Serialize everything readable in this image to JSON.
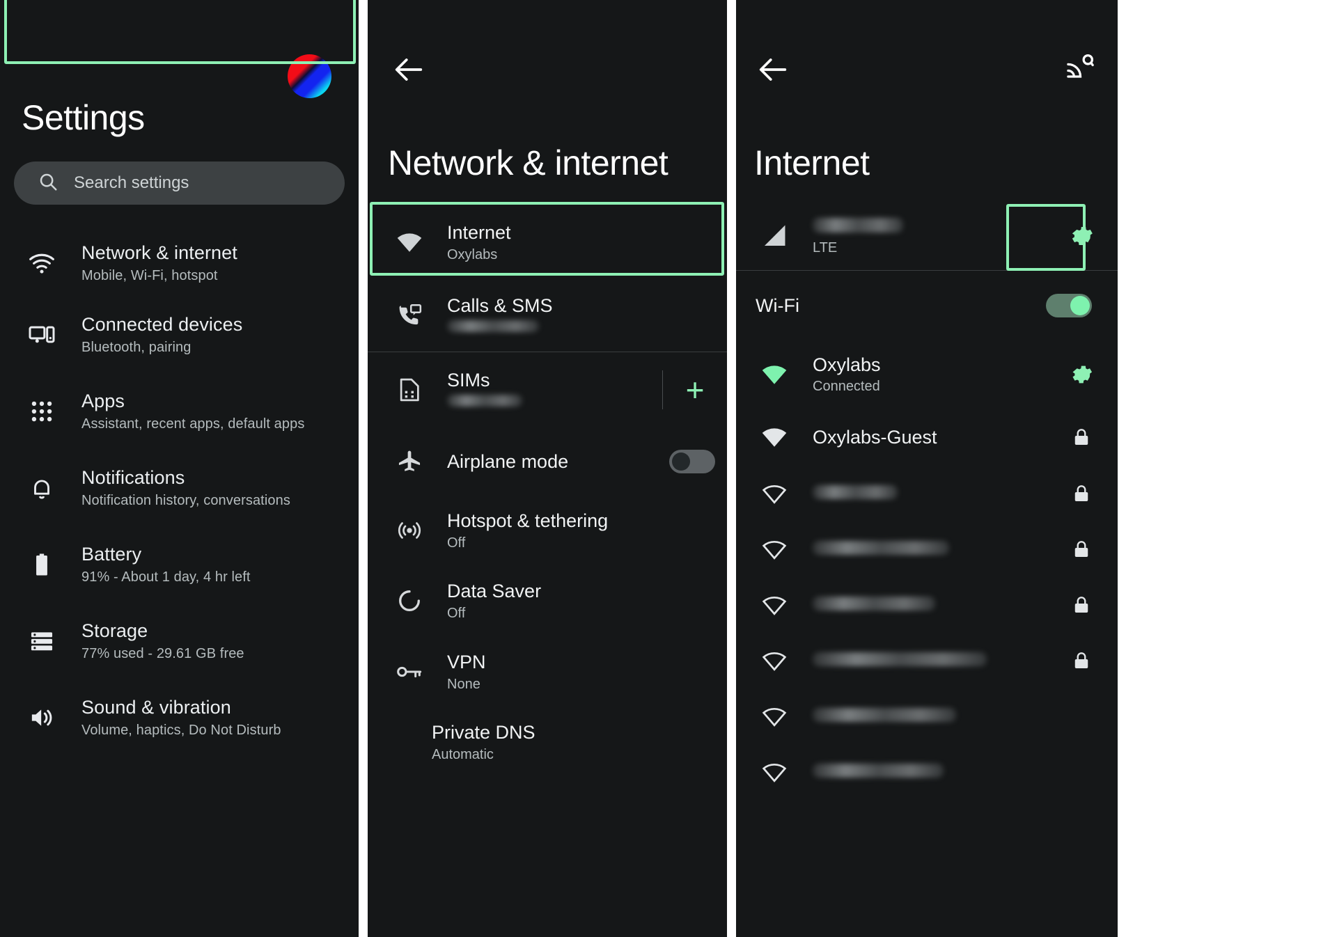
{
  "colors": {
    "background": "#151718",
    "accent_green": "#8ef0b4",
    "highlight_border": "#8ef0b4",
    "text_primary": "#f1f3f4",
    "text_secondary": "#b5bcbe",
    "divider": "#3a3d3f",
    "search_bar": "#3d4143"
  },
  "left_panel": {
    "avatar": "account-avatar",
    "title": "Settings",
    "search": {
      "icon": "search-icon",
      "placeholder": "Search settings",
      "value": ""
    },
    "items": [
      {
        "icon": "wifi-icon",
        "label": "Network & internet",
        "sub": "Mobile, Wi-Fi, hotspot",
        "highlighted": true
      },
      {
        "icon": "connected-devices-icon",
        "label": "Connected devices",
        "sub": "Bluetooth, pairing",
        "highlighted": false
      },
      {
        "icon": "apps-grid-icon",
        "label": "Apps",
        "sub": "Assistant, recent apps, default apps",
        "highlighted": false
      },
      {
        "icon": "bell-icon",
        "label": "Notifications",
        "sub": "Notification history, conversations",
        "highlighted": false
      },
      {
        "icon": "battery-icon",
        "label": "Battery",
        "sub": "91% - About 1 day, 4 hr left",
        "highlighted": false
      },
      {
        "icon": "storage-icon",
        "label": "Storage",
        "sub": "77% used - 29.61 GB free",
        "highlighted": false
      },
      {
        "icon": "volume-icon",
        "label": "Sound & vibration",
        "sub": "Volume, haptics, Do Not Disturb",
        "highlighted": false
      }
    ]
  },
  "mid_panel": {
    "back": "back-arrow-icon",
    "title": "Network & internet",
    "items": [
      {
        "icon": "wifi-icon",
        "label": "Internet",
        "sub": "Oxylabs",
        "sub_blurred": false,
        "highlighted": true,
        "trailing": "none"
      },
      {
        "icon": "calls-sms-icon",
        "label": "Calls & SMS",
        "sub": "",
        "sub_blurred": true,
        "highlighted": false,
        "trailing": "none"
      },
      {
        "icon": "sim-icon",
        "label": "SIMs",
        "sub": "",
        "sub_blurred": true,
        "highlighted": false,
        "trailing": "plus"
      },
      {
        "icon": "airplane-icon",
        "label": "Airplane mode",
        "sub": "",
        "sub_blurred": false,
        "highlighted": false,
        "trailing": "toggle-off"
      },
      {
        "icon": "hotspot-icon",
        "label": "Hotspot & tethering",
        "sub": "Off",
        "sub_blurred": false,
        "highlighted": false,
        "trailing": "none"
      },
      {
        "icon": "data-saver-icon",
        "label": "Data Saver",
        "sub": "Off",
        "sub_blurred": false,
        "highlighted": false,
        "trailing": "none"
      },
      {
        "icon": "vpn-key-icon",
        "label": "VPN",
        "sub": "None",
        "sub_blurred": false,
        "highlighted": false,
        "trailing": "none"
      },
      {
        "icon": "none",
        "label": "Private DNS",
        "sub": "Automatic",
        "sub_blurred": false,
        "highlighted": false,
        "trailing": "none"
      }
    ],
    "add_sim_label": "+"
  },
  "right_panel": {
    "back": "back-arrow-icon",
    "cast": "cast-connected-icon",
    "title": "Internet",
    "carrier": {
      "icon": "signal-bars-icon",
      "name": "",
      "name_blurred": true,
      "sub": "LTE",
      "settings_icon": "gear-icon",
      "settings_highlighted": true
    },
    "wifi_toggle": {
      "label": "Wi-Fi",
      "state": "on"
    },
    "networks": [
      {
        "icon": "wifi-full-icon",
        "icon_color": "green",
        "name": "Oxylabs",
        "name_blurred": false,
        "sub": "Connected",
        "trailing": "gear-icon"
      },
      {
        "icon": "wifi-full-icon",
        "icon_color": "white",
        "name": "Oxylabs-Guest",
        "name_blurred": false,
        "sub": "",
        "trailing": "lock-icon"
      },
      {
        "icon": "wifi-full-icon",
        "icon_color": "white",
        "name": "",
        "name_blurred": true,
        "sub": "",
        "trailing": "lock-icon"
      },
      {
        "icon": "wifi-full-icon",
        "icon_color": "white",
        "name": "",
        "name_blurred": true,
        "sub": "",
        "trailing": "lock-icon"
      },
      {
        "icon": "wifi-full-icon",
        "icon_color": "white",
        "name": "",
        "name_blurred": true,
        "sub": "",
        "trailing": "lock-icon"
      },
      {
        "icon": "wifi-full-icon",
        "icon_color": "white",
        "name": "",
        "name_blurred": true,
        "sub": "",
        "trailing": "lock-icon"
      },
      {
        "icon": "wifi-full-icon",
        "icon_color": "white",
        "name": "",
        "name_blurred": true,
        "sub": "",
        "trailing": "none"
      },
      {
        "icon": "wifi-full-icon",
        "icon_color": "white",
        "name": "",
        "name_blurred": true,
        "sub": "",
        "trailing": "none"
      }
    ]
  }
}
